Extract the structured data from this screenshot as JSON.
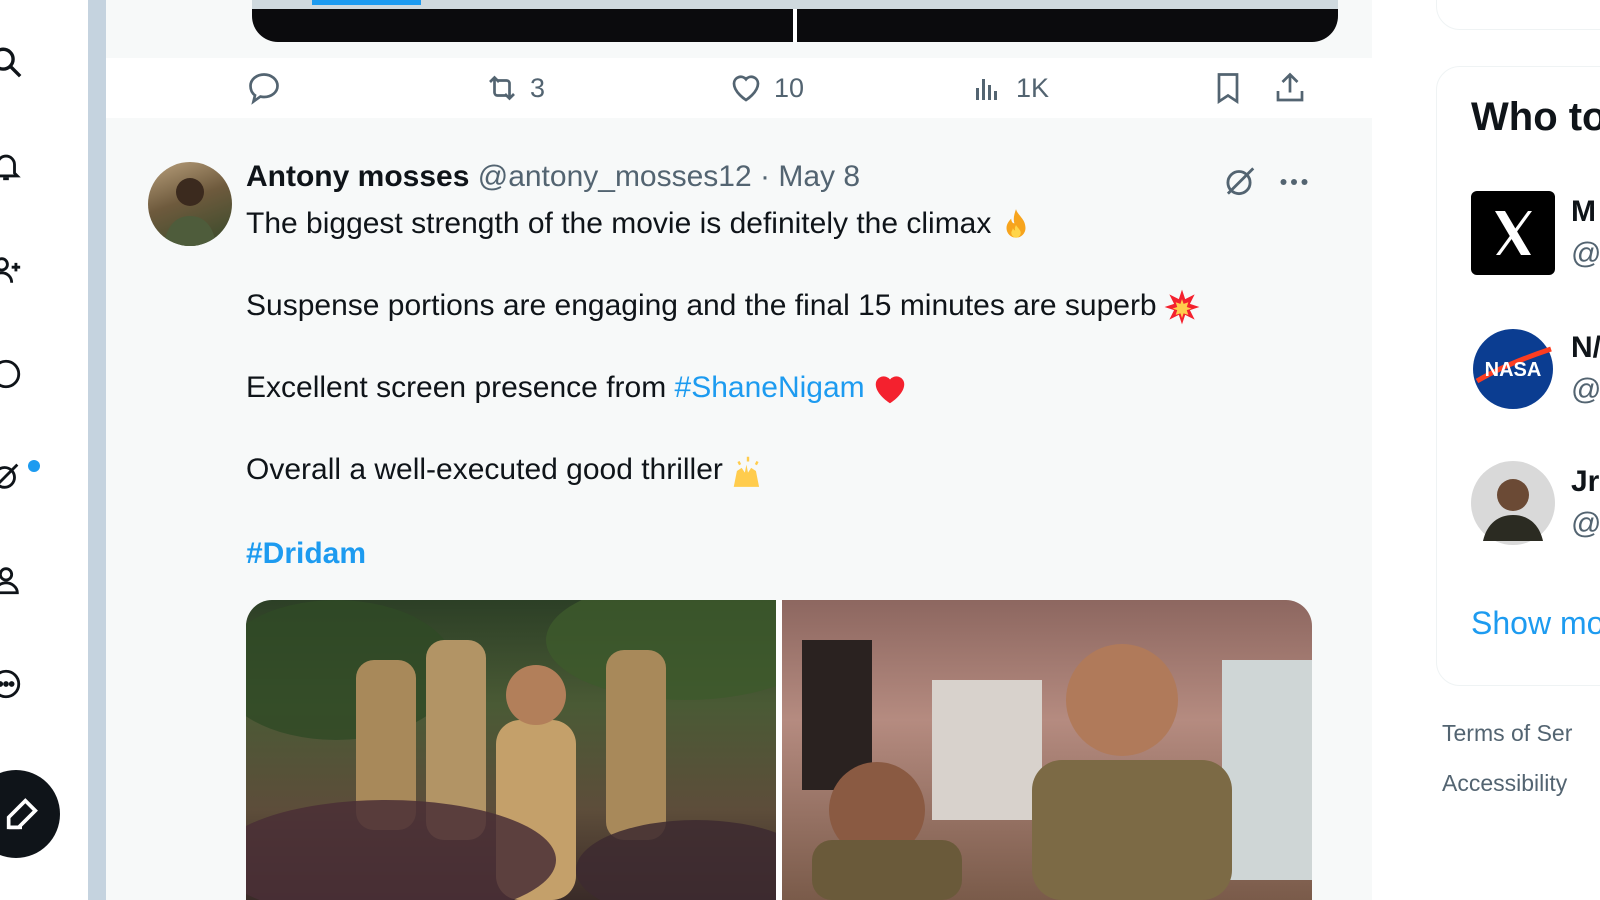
{
  "prev_tweet": {
    "reply_count": "",
    "retweet_count": "3",
    "like_count": "10",
    "view_count": "1K"
  },
  "tweet": {
    "author_name": "Antony mosses",
    "author_handle": "@antony_mosses12",
    "separator": "·",
    "date": "May 8",
    "lines": [
      "The biggest strength of the movie is definitely the climax",
      "Suspense portions are engaging and the final 15 minutes are superb",
      "Excellent screen presence from",
      "Overall a well-executed good thriller"
    ],
    "inline_hashtag": "#ShaneNigam",
    "hashtag": "#Dridam",
    "emojis": [
      "fire-emoji",
      "collision-emoji",
      "red-heart-emoji",
      "raising-hands-emoji"
    ]
  },
  "sidebar": {
    "who_to_follow_title": "Who to",
    "accounts": [
      {
        "name": "M",
        "handle": "@",
        "avatar": "x-logo"
      },
      {
        "name": "N/",
        "handle": "@",
        "avatar": "nasa-logo"
      },
      {
        "name": "Jr",
        "handle": "@",
        "avatar": "person-photo"
      }
    ],
    "show_more": "Show mo",
    "footer_links": [
      "Terms of Ser",
      "Accessibility"
    ]
  },
  "nav": {
    "icons": [
      "search-icon",
      "notifications-icon",
      "follow-icon",
      "messages-icon",
      "grok-icon",
      "profile-icon",
      "more-icon",
      "compose-icon"
    ]
  },
  "colors": {
    "accent": "#1d9bf0",
    "text": "#0f1419",
    "muted": "#536471",
    "heart": "#f4212e"
  },
  "video_progress": 0.1
}
